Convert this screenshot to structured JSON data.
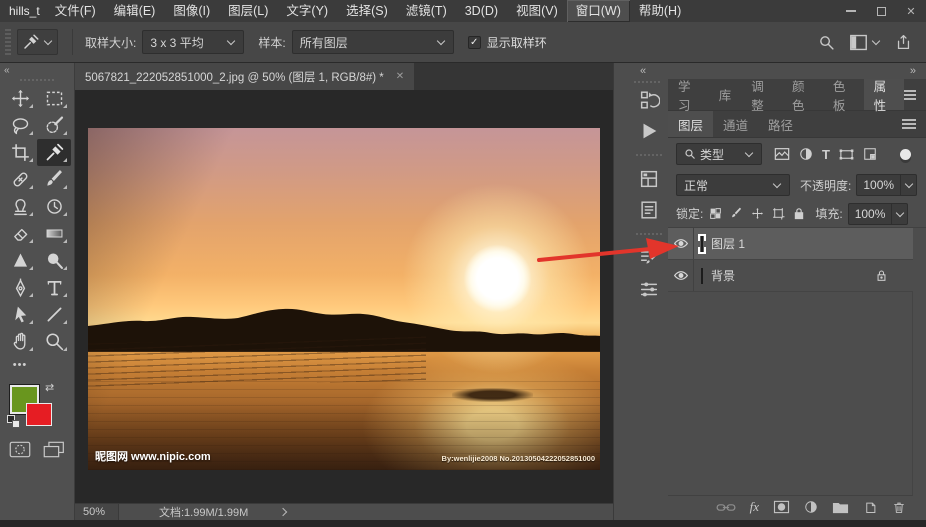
{
  "window": {
    "app_label": "hills_t",
    "controls": [
      "minimize",
      "maximize",
      "close"
    ]
  },
  "menu_bar": {
    "items": [
      {
        "label": "文件(F)"
      },
      {
        "label": "编辑(E)"
      },
      {
        "label": "图像(I)"
      },
      {
        "label": "图层(L)"
      },
      {
        "label": "文字(Y)"
      },
      {
        "label": "选择(S)"
      },
      {
        "label": "滤镜(T)"
      },
      {
        "label": "3D(D)"
      },
      {
        "label": "视图(V)"
      },
      {
        "label": "窗口(W)",
        "highlighted": true
      },
      {
        "label": "帮助(H)"
      }
    ]
  },
  "options_bar": {
    "active_tool_icon": "eyedropper-icon",
    "sample_size_label": "取样大小:",
    "sample_size_value": "3 x 3 平均",
    "sample_label": "样本:",
    "sample_value": "所有图层",
    "show_ring_label": "显示取样环",
    "show_ring_checked": true,
    "right_icons": [
      "search-icon",
      "workspace-icon",
      "share-icon"
    ]
  },
  "document": {
    "tab_title": "5067821_222052851000_2.jpg @ 50% (图层 1, RGB/8#) *",
    "close_glyph": "✕",
    "zoom": "50%",
    "doc_size": "文档:1.99M/1.99M"
  },
  "toolbar": {
    "tools": [
      "move",
      "rectangular-marquee",
      "lasso",
      "quick-selection",
      "crop",
      "eyedropper",
      "spot-healing",
      "brush",
      "clone-stamp",
      "history-brush",
      "eraser",
      "gradient",
      "sharpen",
      "dodge",
      "pen",
      "type",
      "path-selection",
      "line",
      "hand",
      "zoom"
    ],
    "selected_tool": "eyedropper",
    "foreground_color": "#69961e",
    "background_color": "#e61d23"
  },
  "photo": {
    "watermark_left": "昵图网 www.nipic.com",
    "watermark_right": "By:wenlijie2008  No.20130504222052851000"
  },
  "right_panels": {
    "icon_strip": [
      "history",
      "actions",
      "layer-comps",
      "notes",
      "tool-presets",
      "brush-settings"
    ],
    "tab_group_top": {
      "tabs": [
        "学习",
        "库",
        "调整",
        "颜色",
        "色板",
        "属性"
      ],
      "active": "属性"
    },
    "tab_group_layers": {
      "tabs": [
        "图层",
        "通道",
        "路径"
      ],
      "active": "图层"
    },
    "layers_panel": {
      "filter_type_label": "类型",
      "blend_mode": "正常",
      "opacity_label": "不透明度:",
      "opacity_value": "100%",
      "lock_label": "锁定:",
      "fill_label": "填充:",
      "fill_value": "100%",
      "fx_label": "fx",
      "layers": [
        {
          "name": "图层 1",
          "visible": true,
          "selected": true
        },
        {
          "name": "背景",
          "visible": true,
          "locked": true
        }
      ]
    }
  },
  "annotation": {
    "arrow_color": "#e2352b"
  }
}
